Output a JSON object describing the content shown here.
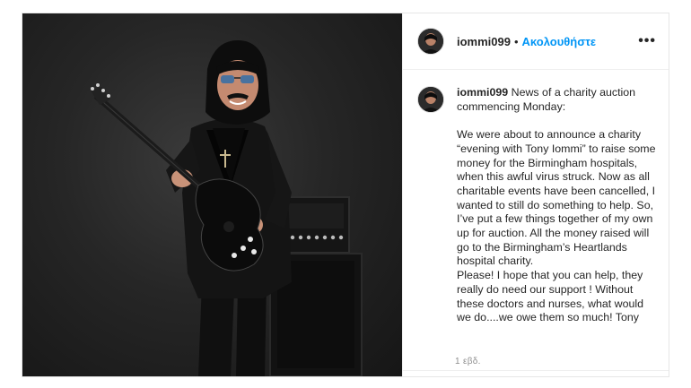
{
  "post": {
    "username": "iommi099",
    "separator": "•",
    "follow_label": "Ακολουθήστε",
    "more_icon": "more-horizontal-icon",
    "caption_username": "iommi099",
    "caption_text": "News of a charity auction commencing Monday:\n\nWe were about to announce a charity “evening with Tony Iommi” to raise some money for the Birmingham hospitals, when this awful virus struck. Now as all charitable events have been cancelled, I wanted to still do something to help. So, I’ve put a few things together of my own up for auction. All the money raised will go to the Birmingham’s Heartlands hospital charity.\nPlease! I hope that you can help, they really do need our support ! Without these doctors and nurses, what would we do....we owe them so much! Tony",
    "timestamp": "1 εβδ."
  },
  "colors": {
    "link": "#0095f6",
    "text": "#262626",
    "muted": "#8e8e8e"
  }
}
